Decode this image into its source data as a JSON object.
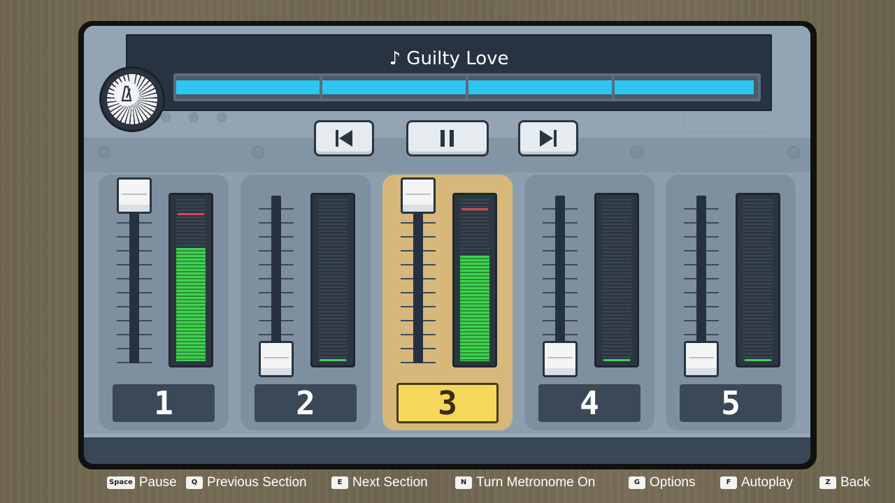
{
  "song": {
    "title": "♪ Guilty Love",
    "progress_segments": [
      1.0,
      1.0,
      1.0,
      0.97
    ]
  },
  "transport": {
    "previous": "previous-section",
    "pause": "pause",
    "next": "next-section"
  },
  "channels": [
    {
      "label": "1",
      "fader_level": 1.0,
      "meter_level": 0.7,
      "peak_level": 0.9,
      "active": false
    },
    {
      "label": "2",
      "fader_level": 0.0,
      "meter_level": 0.0,
      "peak_level": null,
      "active": false
    },
    {
      "label": "3",
      "fader_level": 1.0,
      "meter_level": 0.65,
      "peak_level": 0.93,
      "active": true
    },
    {
      "label": "4",
      "fader_level": 0.0,
      "meter_level": 0.0,
      "peak_level": null,
      "active": false
    },
    {
      "label": "5",
      "fader_level": 0.0,
      "meter_level": 0.0,
      "peak_level": null,
      "active": false
    }
  ],
  "hints": [
    {
      "key": "Space",
      "label": "Pause"
    },
    {
      "key": "Q",
      "label": "Previous Section"
    },
    {
      "key": "E",
      "label": "Next Section"
    },
    {
      "key": "N",
      "label": "Turn Metronome On"
    },
    {
      "key": "G",
      "label": "Options"
    },
    {
      "key": "F",
      "label": "Autoplay"
    },
    {
      "key": "Z",
      "label": "Back"
    }
  ],
  "colors": {
    "accent_progress": "#2cc6f0",
    "meter_green": "#3fd24f",
    "active_channel": "#d7b87a",
    "active_label": "#f5d75c"
  }
}
